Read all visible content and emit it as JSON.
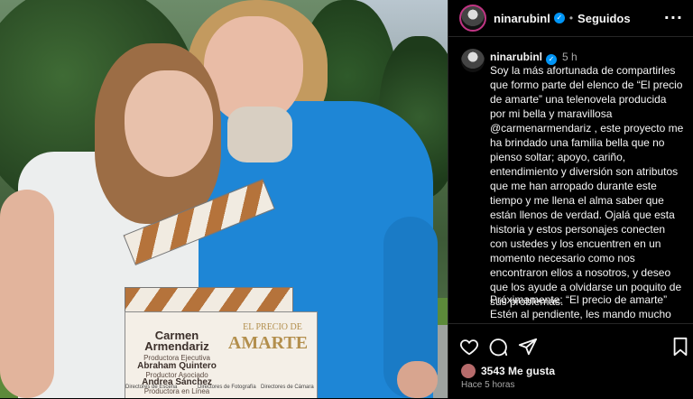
{
  "header": {
    "username": "ninarubinl",
    "follow_status": "Seguidos",
    "more": "···"
  },
  "caption": {
    "username": "ninarubinl",
    "time": "5 h",
    "body": "Soy la más afortunada de compartirles que formo parte del elenco de “El precio de amarte” una telenovela producida por mi bella y maravillosa @carmenarmendariz , este proyecto me ha brindado una familia bella que no pienso soltar; apoyo, cariño, entendimiento y diversión son atributos que me han arropado durante este tiempo y me llena el alma saber que están llenos de verdad. Ojalá que esta historia y estos personajes conecten con ustedes y los encuentren en un momento necesario como nos encontraron ellos a nosotros, y deseo que los ayude a olvidarse un poquito de sus problemas.",
    "body2": "Próximamente: “El precio de amarte”\nEstén al pendiente, les mando mucho"
  },
  "photo": {
    "clapper": {
      "name": "Carmen\nArmendariz",
      "role1": "Productora Ejecutiva",
      "person2": "Abraham Quintero",
      "role2": "Productor Asociado",
      "person3": "Andrea Sánchez",
      "role3": "Productora en Línea",
      "title_small": "EL PRECIO DE",
      "title_big": "AMARTE",
      "foot1": "Directores de Escena",
      "foot2": "Directores de Fotografía",
      "foot3": "Directores de Cámara"
    }
  },
  "actions": {
    "likes": "3543 Me gusta",
    "ago": "Hace 5 horas"
  },
  "colors": {
    "background": "#000000",
    "verified": "#0095f6",
    "muted": "#a8a8a8"
  }
}
